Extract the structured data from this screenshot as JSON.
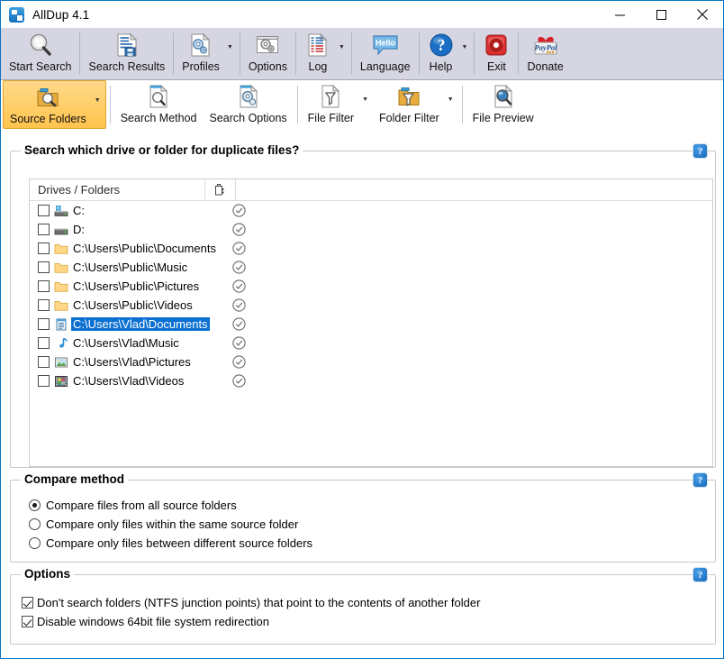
{
  "window": {
    "title": "AllDup 4.1",
    "app_icon": "alldup-app-icon",
    "minimize_label": "Minimize",
    "maximize_label": "Maximize",
    "close_label": "Close",
    "accent_border": "#0a74c4"
  },
  "toolbar": {
    "background": "#d6d6e2",
    "items": [
      {
        "label": "Start Search",
        "icon": "magnifier-icon",
        "dropdown": false
      },
      {
        "label": "Search Results",
        "icon": "document-save-icon",
        "dropdown": false
      },
      {
        "label": "Profiles",
        "icon": "gear-document-icon",
        "dropdown": true
      },
      {
        "label": "Options",
        "icon": "gear-window-icon",
        "dropdown": false
      },
      {
        "label": "Log",
        "icon": "log-list-icon",
        "dropdown": true
      },
      {
        "label": "Language",
        "icon": "speech-bubble-hello-icon",
        "dropdown": false
      },
      {
        "label": "Help",
        "icon": "question-mark-icon",
        "dropdown": true
      },
      {
        "label": "Exit",
        "icon": "power-off-icon",
        "dropdown": false
      },
      {
        "label": "Donate",
        "icon": "paypal-heart-icon",
        "dropdown": false
      }
    ],
    "language_bubble_text": "Hello",
    "paypal_text": "PayPal"
  },
  "tabs": {
    "active": "Source Folders",
    "active_color": "#ffc44d",
    "items": [
      {
        "label": "Source Folders",
        "icon": "folder-search-icon",
        "dropdown": true,
        "active": true
      },
      {
        "label": "Search Method",
        "icon": "document-search-icon",
        "dropdown": false,
        "active": false
      },
      {
        "label": "Search Options",
        "icon": "document-gear-icon",
        "dropdown": false,
        "active": false
      },
      {
        "label": "File Filter",
        "icon": "document-funnel-icon",
        "dropdown": true,
        "active": false
      },
      {
        "label": "Folder Filter",
        "icon": "folder-funnel-icon",
        "dropdown": true,
        "active": false
      },
      {
        "label": "File Preview",
        "icon": "document-preview-icon",
        "dropdown": false,
        "active": false
      }
    ]
  },
  "source_folders": {
    "legend": "Search which drive or folder for duplicate files?",
    "help_icon": "help-question-badge",
    "columns": [
      "Drives / Folders",
      "clipboard-column-icon"
    ],
    "rows": [
      {
        "path": "C:",
        "icon": "system-drive-icon",
        "checked": false,
        "status": "check-circle-icon",
        "selected": false
      },
      {
        "path": "D:",
        "icon": "drive-icon",
        "checked": false,
        "status": "check-circle-icon",
        "selected": false
      },
      {
        "path": "C:\\Users\\Public\\Documents",
        "icon": "folder-icon",
        "checked": false,
        "status": "check-circle-icon",
        "selected": false
      },
      {
        "path": "C:\\Users\\Public\\Music",
        "icon": "folder-icon",
        "checked": false,
        "status": "check-circle-icon",
        "selected": false
      },
      {
        "path": "C:\\Users\\Public\\Pictures",
        "icon": "folder-icon",
        "checked": false,
        "status": "check-circle-icon",
        "selected": false
      },
      {
        "path": "C:\\Users\\Public\\Videos",
        "icon": "folder-icon",
        "checked": false,
        "status": "check-circle-icon",
        "selected": false
      },
      {
        "path": "C:\\Users\\Vlad\\Documents",
        "icon": "documents-library-icon",
        "checked": false,
        "status": "check-circle-icon",
        "selected": true
      },
      {
        "path": "C:\\Users\\Vlad\\Music",
        "icon": "music-note-icon",
        "checked": false,
        "status": "check-circle-icon",
        "selected": false
      },
      {
        "path": "C:\\Users\\Vlad\\Pictures",
        "icon": "picture-icon",
        "checked": false,
        "status": "check-circle-icon",
        "selected": false
      },
      {
        "path": "C:\\Users\\Vlad\\Videos",
        "icon": "film-strip-icon",
        "checked": false,
        "status": "check-circle-icon",
        "selected": false
      }
    ],
    "selection_color": "#0b70d1"
  },
  "compare_method": {
    "legend": "Compare method",
    "help_icon": "help-question-badge",
    "options": [
      {
        "label": "Compare files from all source folders",
        "selected": true
      },
      {
        "label": "Compare only files within the same source folder",
        "selected": false
      },
      {
        "label": "Compare only files between different source folders",
        "selected": false
      }
    ]
  },
  "options": {
    "legend": "Options",
    "help_icon": "help-question-badge",
    "checkboxes": [
      {
        "label": "Don't search folders (NTFS junction points) that point to the contents of another folder",
        "checked": true
      },
      {
        "label": "Disable windows 64bit file system redirection",
        "checked": true
      }
    ]
  }
}
